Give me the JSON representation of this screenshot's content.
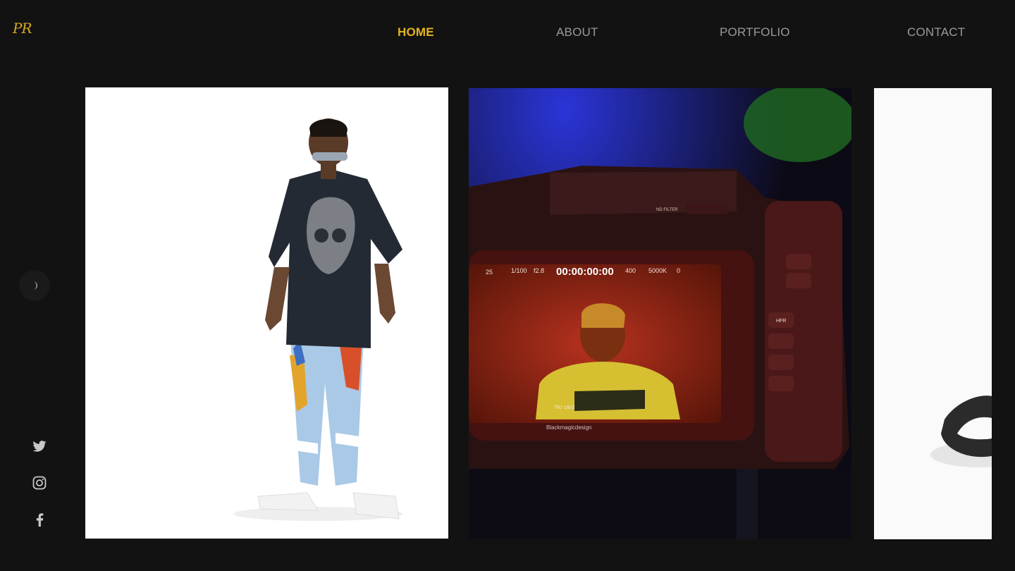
{
  "logo": {
    "text": "PR"
  },
  "nav": {
    "items": [
      {
        "label": "HOME",
        "active": true
      },
      {
        "label": "ABOUT",
        "active": false
      },
      {
        "label": "PORTFOLIO",
        "active": false
      },
      {
        "label": "CONTACT",
        "active": false
      }
    ]
  },
  "sidebar": {
    "theme_toggle_icon": "moon-icon",
    "social": [
      {
        "icon": "twitter-icon"
      },
      {
        "icon": "instagram-icon"
      },
      {
        "icon": "facebook-icon"
      }
    ]
  },
  "gallery": {
    "tiles": [
      {
        "subject": "man-in-graphic-tee-photo"
      },
      {
        "subject": "cinema-camera-monitor-photo"
      },
      {
        "subject": "product-photo-partial"
      }
    ],
    "camera_screen": {
      "timecode": "00:00:00:00",
      "shutter": "1/100",
      "iris": "f2.8",
      "iso": "400",
      "wb": "5000K",
      "tint": "0",
      "fps": "25",
      "card": "No card",
      "brand": "Blackmagicdesign",
      "nd_filter": "ND FILTER",
      "hfr": "HFR"
    }
  },
  "colors": {
    "background": "#121212",
    "accent": "#e3b41f",
    "nav_text": "#9a9a9a",
    "icon": "#c8c8c8"
  }
}
